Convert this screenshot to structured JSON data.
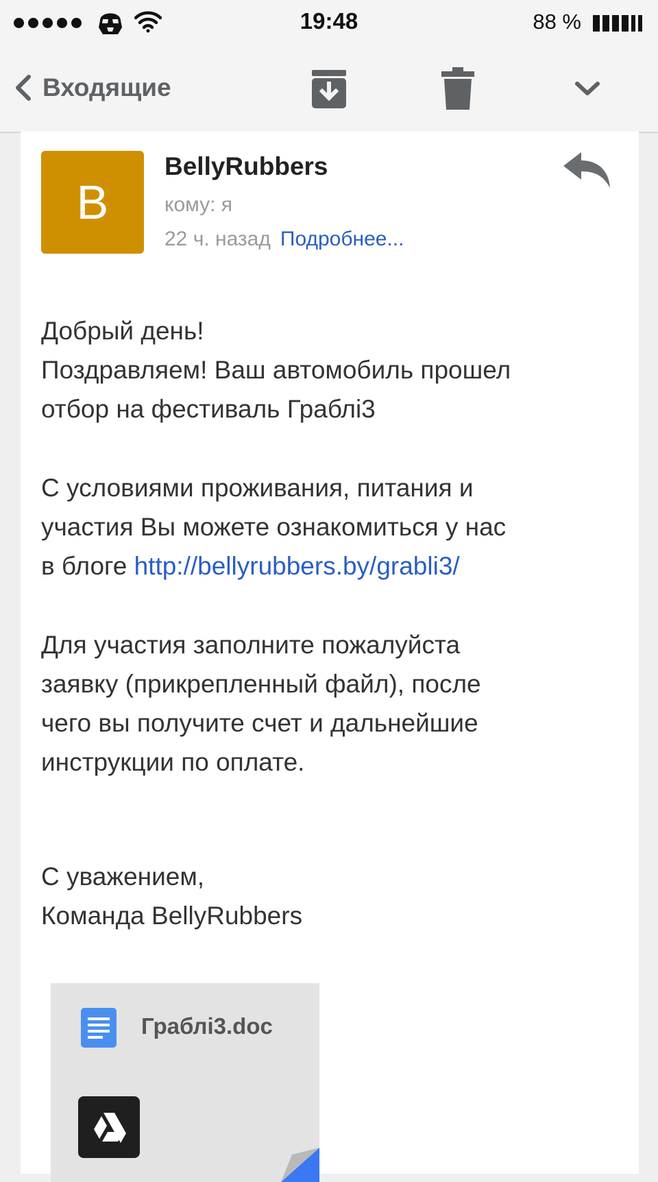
{
  "status_bar": {
    "time": "19:48",
    "battery": "88 %",
    "carrier_icon": "stormtrooper-icon",
    "wifi_icon": "wifi-icon"
  },
  "nav": {
    "back_label": "Входящие",
    "archive_icon": "archive-icon",
    "trash_icon": "trash-icon",
    "more_icon": "chevron-down-icon"
  },
  "message": {
    "avatar_letter": "B",
    "avatar_color": "#cf9000",
    "sender": "BellyRubbers",
    "recipient": "кому: я",
    "time_ago": "22 ч. назад",
    "details_link": "Подробнее...",
    "reply_icon": "reply-icon",
    "body": {
      "greeting": "Добрый день!",
      "line1": "Поздравляем! Ваш автомобиль прошел",
      "line2": "отбор на фестиваль Граблі3",
      "para2_line1": "С условиями проживания, питания и",
      "para2_line2": "участия Вы можете ознакомиться у нас",
      "para2_line3_prefix": "в блоге ",
      "blog_url": "http://bellyrubbers.by/grabli3/",
      "para3_line1": "Для участия заполните пожалуйста",
      "para3_line2": "заявку (прикрепленный файл), после",
      "para3_line3": "чего вы получите счет и дальнейшие",
      "para3_line4": "инструкции по оплате.",
      "signoff": "С уважением,",
      "signature": "Команда BellyRubbers"
    },
    "attachment": {
      "filename": "Граблі3.doc",
      "file_icon": "document-icon",
      "drive_icon": "google-drive-icon"
    }
  },
  "colors": {
    "link": "#2a5ec4",
    "muted": "#9a9a9a",
    "doc_icon": "#4a8ff0"
  }
}
